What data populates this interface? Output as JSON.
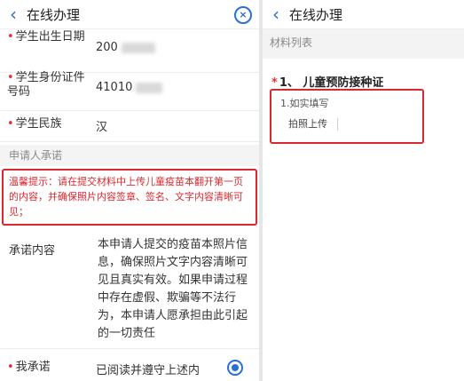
{
  "left": {
    "header": {
      "back_icon": "chevron-left-icon",
      "title": "在线办理",
      "close_icon": "close-circle-icon"
    },
    "fields": [
      {
        "label": "学生出生日期",
        "value": "200"
      },
      {
        "label": "学生身份证件号码",
        "value": "41010"
      },
      {
        "label": "学生民族",
        "value": "汉"
      }
    ],
    "section_title": "申请人承诺",
    "tip": "温馨提示：请在提交材料中上传儿童疫苗本翻开第一页的内容，并确保照片内容签章、签名、文字内容清晰可见；",
    "promise": {
      "label": "承诺内容",
      "text": "本申请人提交的疫苗本照片信息，确保照片文字内容清晰可见且真实有效。如果申请过程中存在虚假、欺骗等不法行为，本申请人愿承担由此引起的一切责任"
    },
    "agree": {
      "label": "我承诺",
      "text": "已阅读并遵守上述内",
      "checked": true
    }
  },
  "right": {
    "header": {
      "back_icon": "chevron-left-icon",
      "title": "在线办理"
    },
    "section_title": "材料列表",
    "item_title": "1、 儿童预防接种证",
    "note": "1.如实填写",
    "upload_label": "拍照上传"
  },
  "colors": {
    "accent": "#2a6fd6",
    "highlight_red": "#d9282f"
  }
}
